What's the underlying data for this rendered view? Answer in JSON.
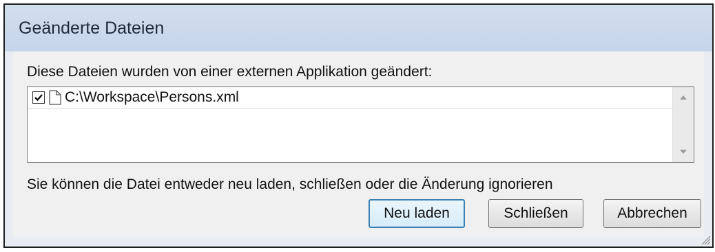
{
  "window": {
    "title": "Geänderte Dateien"
  },
  "message_top": "Diese Dateien wurden von einer externen Applikation geändert:",
  "files": [
    {
      "path": "C:\\Workspace\\Persons.xml",
      "checked": true
    }
  ],
  "message_bottom": "Sie können die Datei entweder neu laden, schließen oder die Änderung ignorieren",
  "buttons": {
    "reload": "Neu laden",
    "close": "Schließen",
    "cancel": "Abbrechen"
  }
}
